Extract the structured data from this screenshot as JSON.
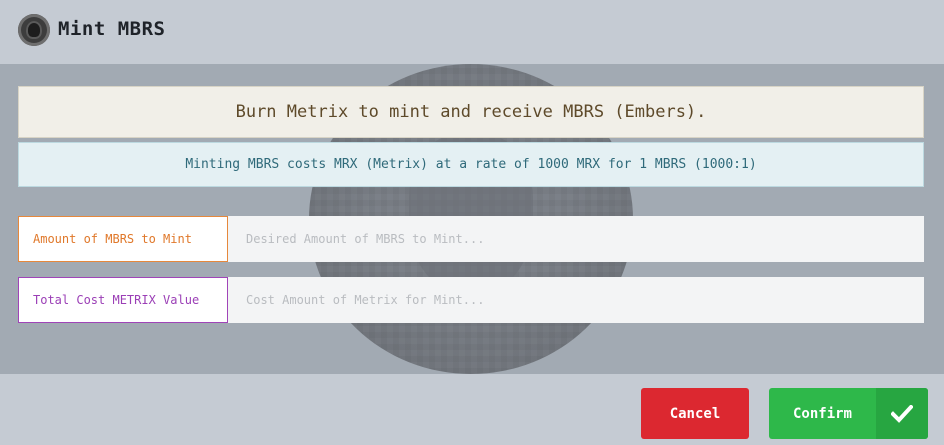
{
  "header": {
    "title": "Mint MBRS",
    "logo_icon": "mbrs-coin-logo"
  },
  "banner": {
    "text": "Burn Metrix to mint and receive MBRS (Embers)."
  },
  "info": {
    "text": "Minting MBRS costs MRX (Metrix) at a rate of 1000 MRX for 1 MBRS (1000:1)"
  },
  "form": {
    "amount": {
      "label": "Amount of MBRS to Mint",
      "placeholder": "Desired Amount of MBRS to Mint...",
      "value": ""
    },
    "cost": {
      "label": "Total Cost METRIX Value",
      "placeholder": "Cost Amount of Metrix for Mint...",
      "value": ""
    }
  },
  "footer": {
    "cancel_label": "Cancel",
    "confirm_label": "Confirm",
    "confirm_icon": "checkmark-icon"
  },
  "colors": {
    "amount_accent": "#e0782a",
    "cost_accent": "#9b3fb6",
    "cancel": "#dc2830",
    "confirm": "#2eb84a"
  }
}
